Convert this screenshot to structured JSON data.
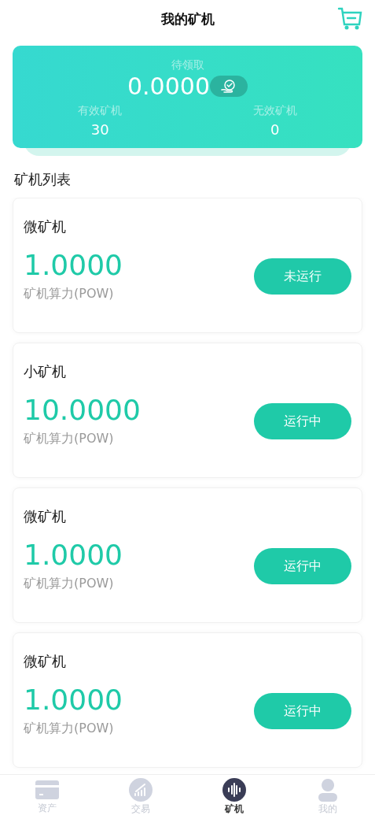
{
  "header": {
    "title": "我的矿机"
  },
  "summary": {
    "pending_label": "待领取",
    "pending_value": "0.0000",
    "stats": [
      {
        "label": "有效矿机",
        "value": "30"
      },
      {
        "label": "无效矿机",
        "value": "0"
      }
    ]
  },
  "section_title": "矿机列表",
  "miners": [
    {
      "name": "微矿机",
      "power": "1.0000",
      "caption": "矿机算力(POW)",
      "status": "未运行",
      "running": false
    },
    {
      "name": "小矿机",
      "power": "10.0000",
      "caption": "矿机算力(POW)",
      "status": "运行中",
      "running": true
    },
    {
      "name": "微矿机",
      "power": "1.0000",
      "caption": "矿机算力(POW)",
      "status": "运行中",
      "running": true
    },
    {
      "name": "微矿机",
      "power": "1.0000",
      "caption": "矿机算力(POW)",
      "status": "运行中",
      "running": true
    }
  ],
  "tab_bar": [
    {
      "kind": "card",
      "label": "资产",
      "selected": false
    },
    {
      "kind": "chart",
      "label": "交易",
      "selected": false
    },
    {
      "kind": "wave",
      "label": "矿机",
      "selected": true
    },
    {
      "kind": "person",
      "label": "我的",
      "selected": false
    }
  ]
}
